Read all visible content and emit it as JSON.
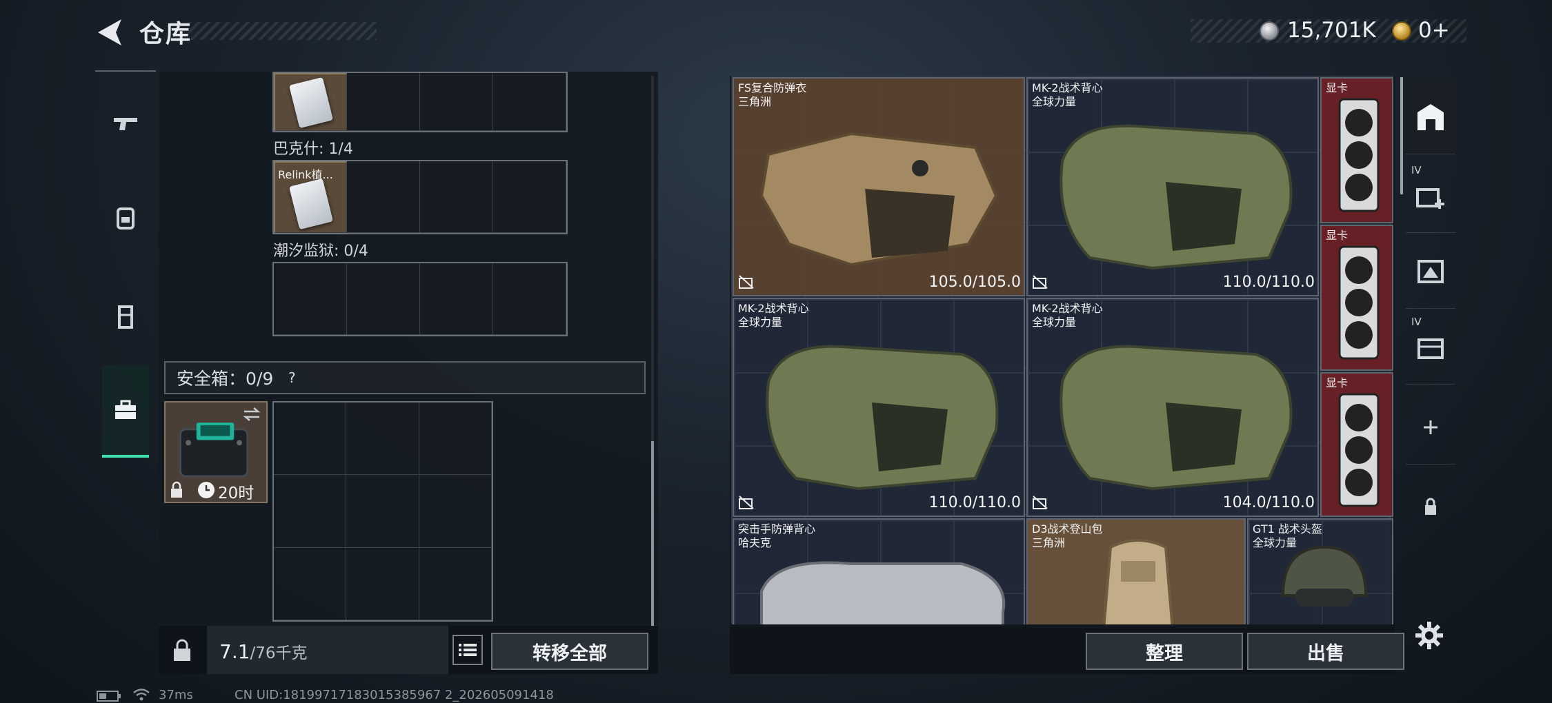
{
  "header": {
    "title": "仓库",
    "currency_silver": "15,701K",
    "currency_gold": "0+"
  },
  "side_tabs": [
    {
      "icon": "gun-icon"
    },
    {
      "icon": "backpack-icon"
    },
    {
      "icon": "vest-icon"
    },
    {
      "icon": "briefcase-icon",
      "active": true
    }
  ],
  "left_panel": {
    "sections": [
      {
        "label": "巴克什: 1/4",
        "thumb_label": "Relink植..."
      },
      {
        "label": "潮汐监狱: 0/4"
      }
    ],
    "safe_box": {
      "header": "安全箱：0/9",
      "help": "?",
      "timer": "20时"
    },
    "weight": "7.1",
    "weight_max": "/76千克",
    "transfer_all": "转移全部"
  },
  "stash": {
    "items": [
      {
        "name": "FS复合防弹衣\n三角洲",
        "durability": "105.0/105.0",
        "kind": "armor-tan"
      },
      {
        "name": "MK-2战术背心\n全球力量",
        "durability": "110.0/110.0",
        "kind": "vest-green"
      },
      {
        "name": "显卡",
        "kind": "gpu"
      },
      {
        "name": "显卡",
        "kind": "gpu"
      },
      {
        "name": "MK-2战术背心\n全球力量",
        "durability": "110.0/110.0",
        "kind": "vest-green"
      },
      {
        "name": "MK-2战术背心\n全球力量",
        "durability": "104.0/110.0",
        "kind": "vest-green"
      },
      {
        "name": "显卡",
        "kind": "gpu"
      },
      {
        "name": "突击手防弹背心\n哈夫克",
        "kind": "vest-grey"
      },
      {
        "name": "D3战术登山包\n三角洲",
        "kind": "backpack"
      },
      {
        "name": "GT1 战术头盔\n全球力量",
        "kind": "helmet"
      }
    ],
    "sort": "整理",
    "sell": "出售"
  },
  "right_tabs": [
    {
      "icon": "stash-icon",
      "active": true
    },
    {
      "icon": "add-stash-icon",
      "label": "IV"
    },
    {
      "icon": "expand-icon"
    },
    {
      "icon": "stack-icon",
      "label": "IV"
    },
    {
      "icon": "plus-icon"
    },
    {
      "icon": "lock-icon"
    }
  ],
  "status_bar": {
    "ping": "37ms",
    "uid": "CN UID:18199717183015385967 2_202605091418"
  },
  "colors": {
    "accent": "#3fe3b0",
    "panel": "#141a21",
    "gpu_bg": "#6e2024",
    "brown_bg": "#5c4230"
  }
}
